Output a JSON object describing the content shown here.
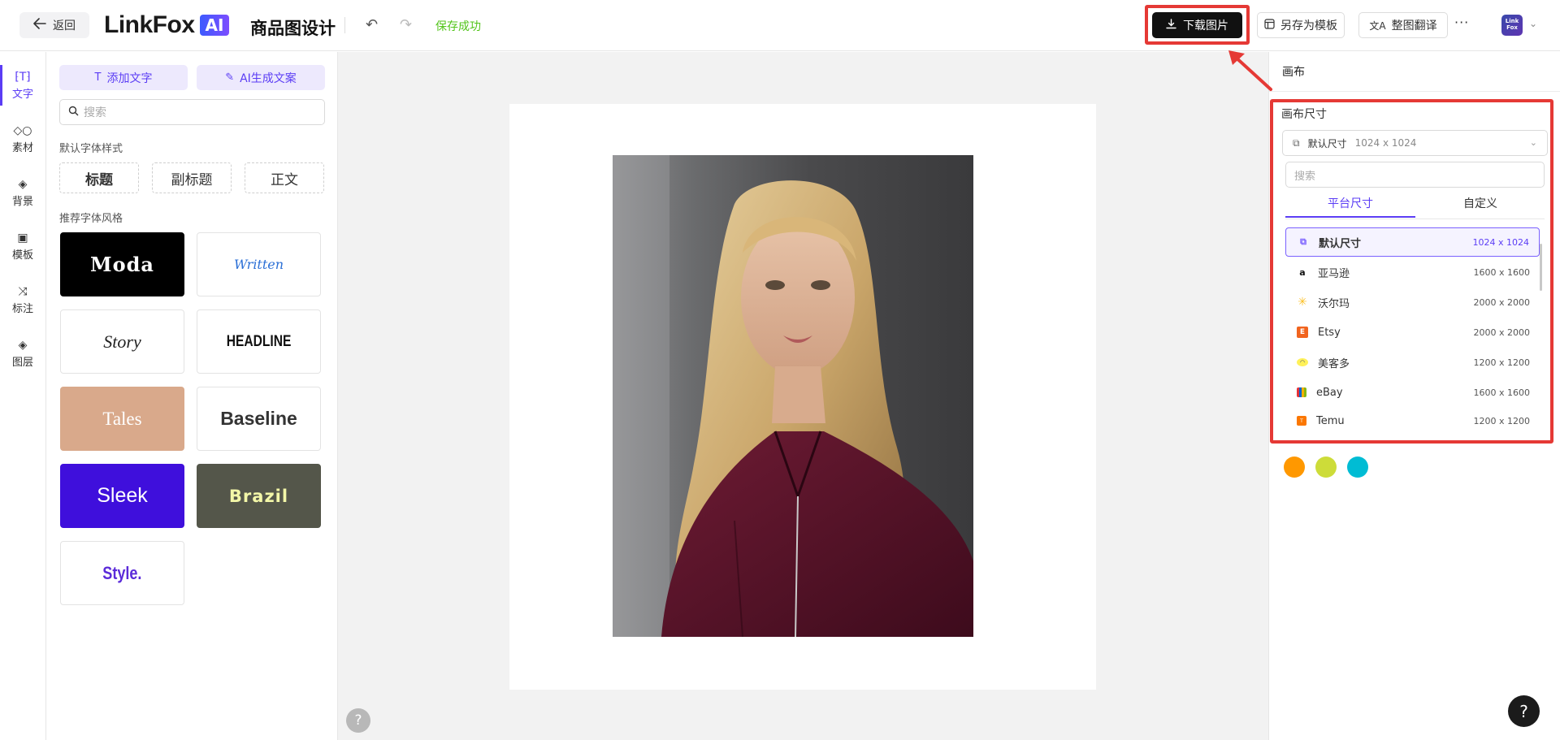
{
  "header": {
    "back_label": "返回",
    "logo_text": "LinkFox",
    "logo_badge": "AI",
    "page_title": "商品图设计",
    "save_status": "保存成功",
    "download_label": "下载图片",
    "save_template_label": "另存为模板",
    "translate_label": "整图翻译",
    "more_label": "···",
    "avatar_text": "Link Fox"
  },
  "rail": {
    "items": [
      {
        "label": "文字",
        "icon": "text-icon",
        "active": true
      },
      {
        "label": "素材",
        "icon": "shapes-icon"
      },
      {
        "label": "背景",
        "icon": "layers-icon"
      },
      {
        "label": "模板",
        "icon": "template-icon"
      },
      {
        "label": "标注",
        "icon": "annotation-icon"
      },
      {
        "label": "图层",
        "icon": "layer-icon"
      }
    ]
  },
  "text_panel": {
    "add_text_label": "添加文字",
    "ai_copy_label": "AI生成文案",
    "search_placeholder": "搜索",
    "default_styles_label": "默认字体样式",
    "styles": [
      "标题",
      "副标题",
      "正文"
    ],
    "recommended_label": "推荐字体风格",
    "font_cards": [
      "Moda",
      "Written",
      "Story",
      "HEADLINE",
      "Tales",
      "Baseline",
      "Sleek",
      "Brazil",
      "Style."
    ]
  },
  "canvas": {
    "help_label": "?"
  },
  "right_panel": {
    "title": "画布",
    "size_label": "画布尺寸",
    "selected_name": "默认尺寸",
    "selected_size": "1024 x 1024",
    "search_placeholder": "搜索",
    "tabs": [
      "平台尺寸",
      "自定义"
    ],
    "options": [
      {
        "name": "默认尺寸",
        "size": "1024 x 1024",
        "icon": "default-size-icon"
      },
      {
        "name": "亚马逊",
        "size": "1600 x 1600",
        "icon": "amazon-icon"
      },
      {
        "name": "沃尔玛",
        "size": "2000 x 2000",
        "icon": "walmart-icon"
      },
      {
        "name": "Etsy",
        "size": "2000 x 2000",
        "icon": "etsy-icon"
      },
      {
        "name": "美客多",
        "size": "1200 x 1200",
        "icon": "mercadolibre-icon"
      },
      {
        "name": "eBay",
        "size": "1600 x 1600",
        "icon": "ebay-icon"
      },
      {
        "name": "Temu",
        "size": "1200 x 1200",
        "icon": "temu-icon"
      }
    ],
    "swatches": [
      "#ff9800",
      "#cddc39",
      "#00bcd4"
    ],
    "help_label": "?"
  },
  "colors": {
    "accent": "#5b3df5",
    "highlight": "#e53935",
    "success": "#52c41a"
  }
}
